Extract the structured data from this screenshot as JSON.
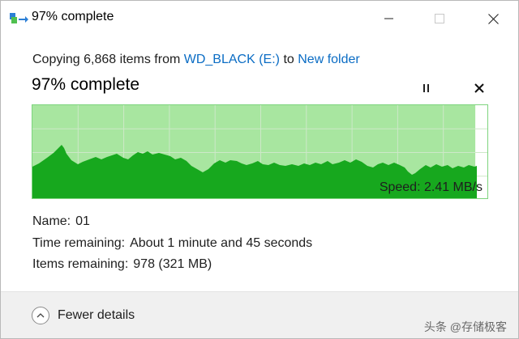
{
  "window": {
    "title": "97% complete",
    "icon": "copy-files-icon"
  },
  "copy": {
    "prefix": "Copying 6,868 items from ",
    "source": "WD_BLACK (E:)",
    "middle": " to ",
    "destination": "New folder"
  },
  "progress": {
    "title": "97% complete",
    "percent": 97,
    "speed": "Speed: 2.41 MB/s"
  },
  "details": {
    "name_label": "Name:",
    "name_value": "01",
    "time_label": "Time remaining:",
    "time_value": "About 1 minute and 45 seconds",
    "items_label": "Items remaining:",
    "items_value": "978 (321 MB)"
  },
  "footer": {
    "fewer_details": "Fewer details",
    "watermark": "头条 @存储极客"
  },
  "colors": {
    "graph_light": "#a8e6a0",
    "graph_dark": "#17a81e",
    "graph_grid": "#cde8c8",
    "link": "#0a6cc4"
  }
}
